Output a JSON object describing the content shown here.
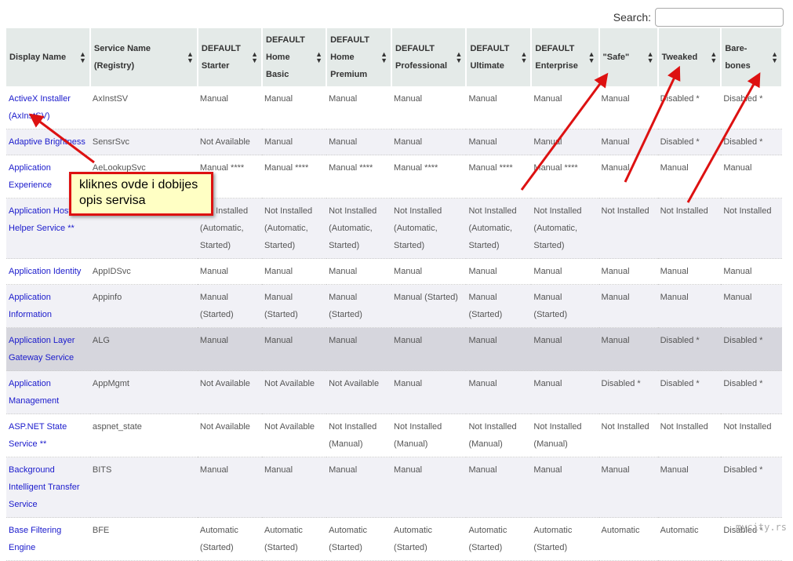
{
  "search": {
    "label": "Search:",
    "value": ""
  },
  "columns": [
    "Display Name",
    "Service Name (Registry)",
    "DEFAULT Starter",
    "DEFAULT Home Basic",
    "DEFAULT Home Premium",
    "DEFAULT Professional",
    "DEFAULT Ultimate",
    "DEFAULT Enterprise",
    "\"Safe\"",
    "Tweaked",
    "Bare-bones"
  ],
  "rows": [
    [
      "ActiveX Installer (AxInstSV)",
      "AxInstSV",
      "Manual",
      "Manual",
      "Manual",
      "Manual",
      "Manual",
      "Manual",
      "Manual",
      "Disabled *",
      "Disabled *"
    ],
    [
      "Adaptive Brightness",
      "SensrSvc",
      "Not Available",
      "Manual",
      "Manual",
      "Manual",
      "Manual",
      "Manual",
      "Manual",
      "Disabled *",
      "Disabled *"
    ],
    [
      "Application Experience",
      "AeLookupSvc",
      "Manual ****",
      "Manual ****",
      "Manual ****",
      "Manual ****",
      "Manual ****",
      "Manual ****",
      "Manual",
      "Manual",
      "Manual"
    ],
    [
      "Application Host Helper Service **",
      "",
      "Not Installed (Automatic, Started)",
      "Not Installed (Automatic, Started)",
      "Not Installed (Automatic, Started)",
      "Not Installed (Automatic, Started)",
      "Not Installed (Automatic, Started)",
      "Not Installed (Automatic, Started)",
      "Not Installed",
      "Not Installed",
      "Not Installed"
    ],
    [
      "Application Identity",
      "AppIDSvc",
      "Manual",
      "Manual",
      "Manual",
      "Manual",
      "Manual",
      "Manual",
      "Manual",
      "Manual",
      "Manual"
    ],
    [
      "Application Information",
      "Appinfo",
      "Manual (Started)",
      "Manual (Started)",
      "Manual (Started)",
      "Manual (Started)",
      "Manual (Started)",
      "Manual (Started)",
      "Manual",
      "Manual",
      "Manual"
    ],
    [
      "Application Layer Gateway Service",
      "ALG",
      "Manual",
      "Manual",
      "Manual",
      "Manual",
      "Manual",
      "Manual",
      "Manual",
      "Disabled *",
      "Disabled *"
    ],
    [
      "Application Management",
      "AppMgmt",
      "Not Available",
      "Not Available",
      "Not Available",
      "Manual",
      "Manual",
      "Manual",
      "Disabled *",
      "Disabled *",
      "Disabled *"
    ],
    [
      "ASP.NET State Service **",
      "aspnet_state",
      "Not Available",
      "Not Available",
      "Not Installed (Manual)",
      "Not Installed (Manual)",
      "Not Installed (Manual)",
      "Not Installed (Manual)",
      "Not Installed",
      "Not Installed",
      "Not Installed"
    ],
    [
      "Background Intelligent Transfer Service",
      "BITS",
      "Manual",
      "Manual",
      "Manual",
      "Manual",
      "Manual",
      "Manual",
      "Manual",
      "Manual",
      "Disabled *"
    ],
    [
      "Base Filtering Engine",
      "BFE",
      "Automatic (Started)",
      "Automatic (Started)",
      "Automatic (Started)",
      "Automatic (Started)",
      "Automatic (Started)",
      "Automatic (Started)",
      "Automatic",
      "Automatic",
      "Disabled *"
    ]
  ],
  "callout": "kliknes ovde i dobijes opis servisa",
  "watermark": "mycity.rs",
  "colors": {
    "link": "#1a1acc",
    "header": "#e4eae8",
    "arrow": "#dd1111"
  }
}
